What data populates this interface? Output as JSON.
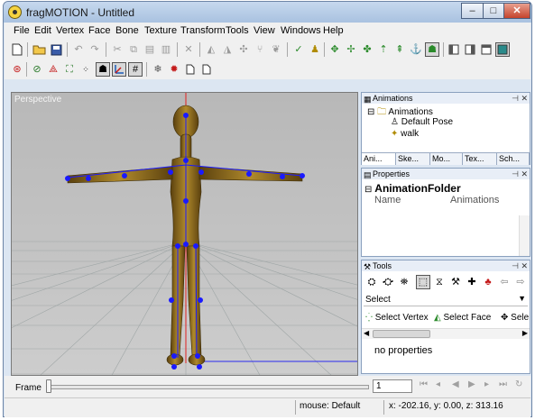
{
  "window": {
    "title": "fragMOTION - Untitled",
    "controls": {
      "minimize": "–",
      "maximize": "□",
      "close": "✕"
    }
  },
  "menu": {
    "items": [
      "File",
      "Edit",
      "Vertex",
      "Face",
      "Bone",
      "Texture",
      "Transform",
      "Tools",
      "View",
      "Windows",
      "Help"
    ]
  },
  "viewport": {
    "label": "Perspective"
  },
  "animations_panel": {
    "title": "Animations",
    "tree": {
      "root": "Animations",
      "children": [
        "Default Pose",
        "walk"
      ]
    },
    "tabs": [
      "Ani...",
      "Ske...",
      "Mo...",
      "Tex...",
      "Sch..."
    ]
  },
  "properties_panel": {
    "title": "Properties",
    "category": "AnimationFolder",
    "rows": [
      {
        "name": "Name",
        "value": "Animations"
      }
    ]
  },
  "tools_panel": {
    "title": "Tools",
    "select_value": "Select",
    "tools": [
      "Select Vertex",
      "Select Face",
      "Sele"
    ],
    "no_properties": "no properties"
  },
  "timeline": {
    "frame_label": "Frame",
    "frame_value": "1"
  },
  "statusbar": {
    "mouse_mode": "mouse: Default",
    "coords": "x: -202.16, y: 0.00, z: 313.16"
  },
  "colors": {
    "accent": "#6d85a6",
    "bone_joint": "#1a1aff",
    "character": "#8b6a1e",
    "axis_red": "#e02020"
  }
}
